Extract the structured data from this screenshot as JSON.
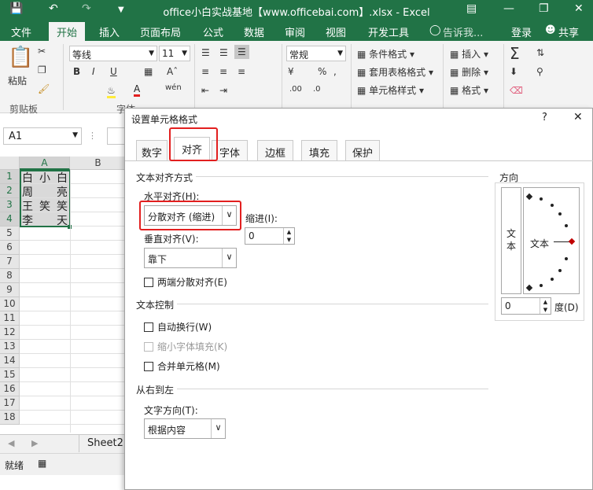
{
  "titlebar": {
    "title": "office小白实战基地【www.officebai.com】.xlsx - Excel"
  },
  "tabs": [
    {
      "label": "文件"
    },
    {
      "label": "开始"
    },
    {
      "label": "插入"
    },
    {
      "label": "页面布局"
    },
    {
      "label": "公式"
    },
    {
      "label": "数据"
    },
    {
      "label": "审阅"
    },
    {
      "label": "视图"
    },
    {
      "label": "开发工具"
    },
    {
      "label": "告诉我..."
    },
    {
      "label": "登录"
    },
    {
      "label": "共享"
    }
  ],
  "ribbon": {
    "paste_label": "粘贴",
    "clipboard_group": "剪贴板",
    "font_group": "字体",
    "font_name": "等线",
    "font_size": "11",
    "bold": "B",
    "italic": "I",
    "underline": "U",
    "number_format": "常规",
    "cond_format": "条件格式",
    "table_format": "套用表格格式",
    "cell_style": "单元格样式",
    "insert": "插入",
    "delete": "删除",
    "format": "格式",
    "percent": "%"
  },
  "namebox": "A1",
  "grid": {
    "columns": [
      "A",
      "B"
    ],
    "rows": [
      "1",
      "2",
      "3",
      "4",
      "5",
      "6",
      "7",
      "8",
      "9",
      "10",
      "11",
      "12",
      "13",
      "14",
      "15",
      "16",
      "17",
      "18"
    ],
    "cells": [
      [
        "白",
        "小",
        "白"
      ],
      [
        "周",
        "",
        "亮"
      ],
      [
        "王",
        "笑",
        "笑"
      ],
      [
        "李",
        "",
        "天"
      ]
    ],
    "sheet_tab": "Sheet2",
    "status": "就绪"
  },
  "dialog": {
    "title": "设置单元格格式",
    "help": "?",
    "close": "✕",
    "tabs": [
      "数字",
      "对齐",
      "字体",
      "边框",
      "填充",
      "保护"
    ],
    "active_tab": "对齐",
    "text_align_section": "文本对齐方式",
    "horizontal_label": "水平对齐(H):",
    "horizontal_value": "分散对齐 (缩进)",
    "indent_label": "缩进(I):",
    "indent_value": "0",
    "vertical_label": "垂直对齐(V):",
    "vertical_value": "靠下",
    "justify_distributed": "两端分散对齐(E)",
    "text_control_section": "文本控制",
    "wrap_text": "自动换行(W)",
    "shrink_to_fit": "缩小字体填充(K)",
    "merge_cells": "合并单元格(M)",
    "rtl_section": "从右到左",
    "text_direction_label": "文字方向(T):",
    "text_direction_value": "根据内容",
    "orientation_section": "方向",
    "vertical_text": "文本",
    "orientation_text": "文本",
    "degree_value": "0",
    "degree_label": "度(D)"
  }
}
